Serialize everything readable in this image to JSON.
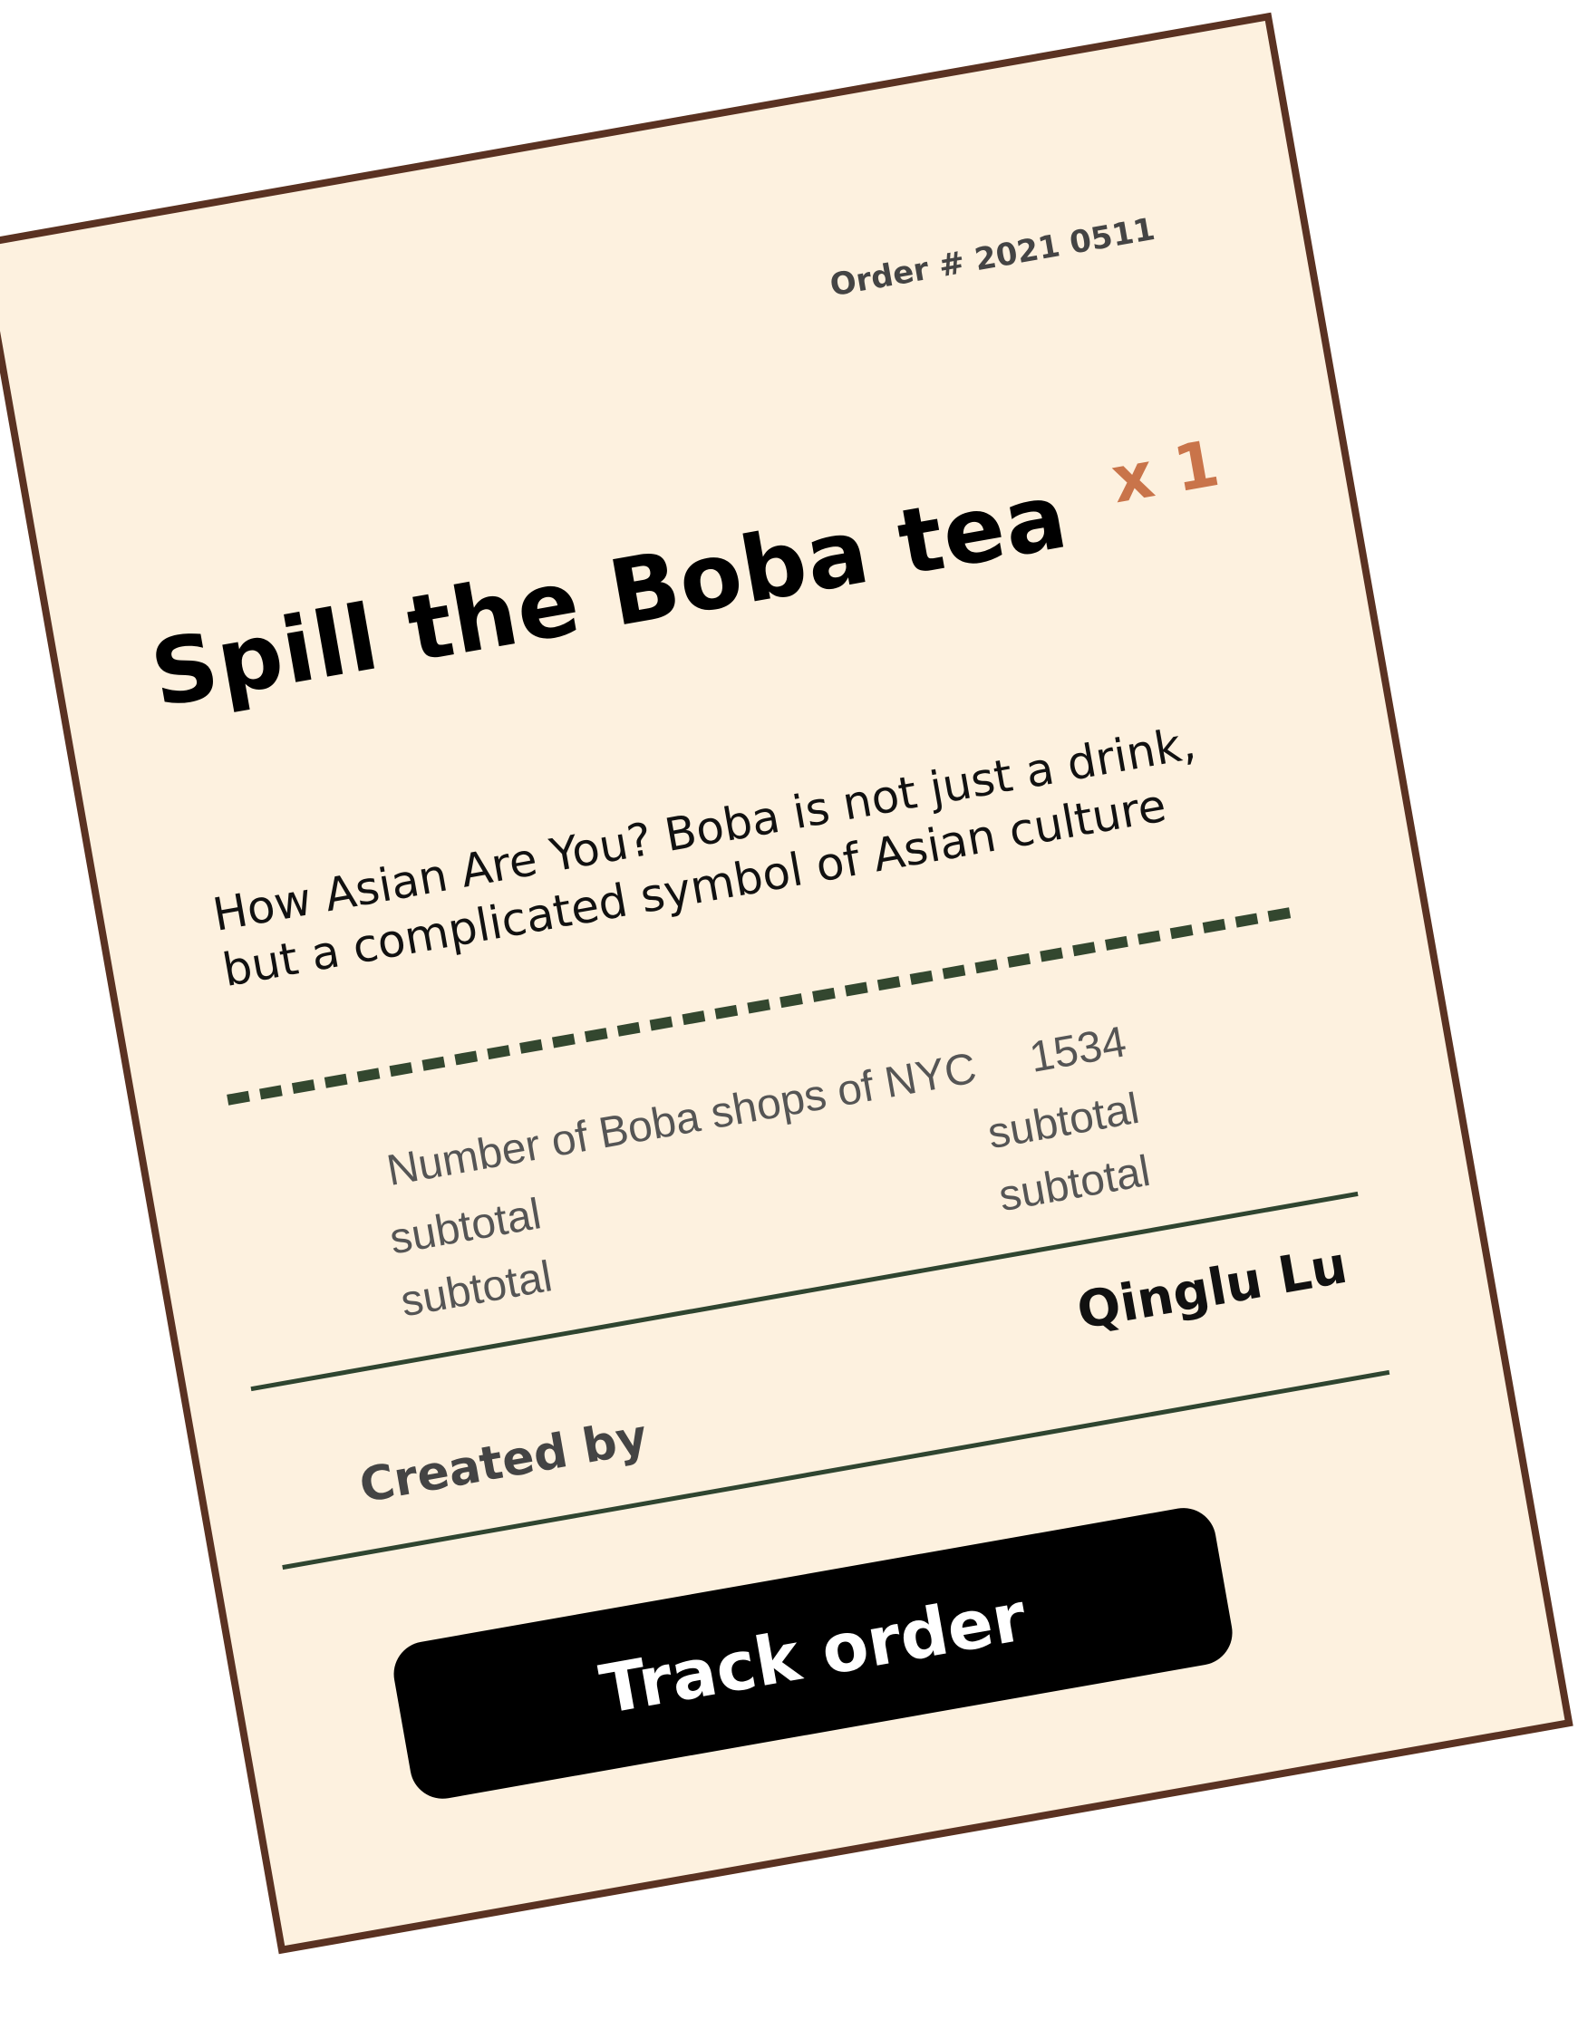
{
  "order": {
    "number": "Order # 2021 0511"
  },
  "product": {
    "title": "Spill the Boba tea",
    "quantity": "x 1",
    "description": "How Asian Are You? Boba is not just a drink, but a complicated symbol of Asian culture"
  },
  "stats": {
    "label": "Number of Boba shops of NYC",
    "value": "1534",
    "subtotals_left": [
      "subtotal",
      "subtotal"
    ],
    "subtotals_right": [
      "subtotal",
      "subtotal"
    ]
  },
  "credits": {
    "label": "Created by",
    "author": "Qinglu Lu"
  },
  "actions": {
    "track_label": "Track order"
  },
  "colors": {
    "paper": "#fdf1df",
    "border": "#5a3222",
    "accent": "#c9744a",
    "rule": "#33472f",
    "button": "#000000"
  }
}
